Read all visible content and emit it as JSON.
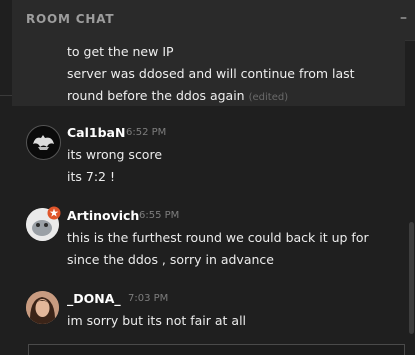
{
  "header": {
    "title": "ROOM CHAT",
    "minimize_label": "–"
  },
  "top_message": {
    "lines": [
      "to get the new IP",
      "server was ddosed and will continue from last",
      "round before the ddos again"
    ],
    "edited_label": "(edited)"
  },
  "messages": [
    {
      "name": "Cal1baN",
      "time": "6:52 PM",
      "lines": [
        "its wrong score",
        "its 7:2 !"
      ],
      "avatar": "skull-logo-avatar"
    },
    {
      "name": "Artinovich",
      "time": "6:55 PM",
      "lines": [
        "this is the furthest round we could back it up for",
        "since the ddos , sorry in advance"
      ],
      "avatar": "creature-avatar"
    },
    {
      "name": "_DONA_",
      "time": "7:03 PM",
      "lines": [
        "im sorry but its not fair at all"
      ],
      "avatar": "woman-photo-avatar"
    }
  ],
  "colors": {
    "background": "#1f1f1f",
    "panel": "#2a2a2a",
    "badge": "#e0552a"
  }
}
